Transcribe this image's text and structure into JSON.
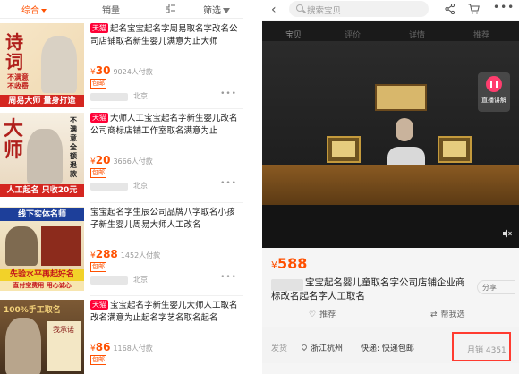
{
  "left": {
    "sort": {
      "comprehensive": "综合",
      "sales": "销量",
      "filter": "筛选"
    },
    "items": [
      {
        "badge": "天猫",
        "title": "起名宝宝起名字周易取名字改名公司店铺取名新生婴儿满意为止大师",
        "price_symbol": "¥",
        "price": "30",
        "sold": "9024人付款",
        "tag": "包邮",
        "location": "北京",
        "thumb": {
          "big": "诗词",
          "side": "不满意不收费",
          "band": "周易大师 量身打造"
        }
      },
      {
        "badge": "天猫",
        "title": "大师人工宝宝起名字新生婴儿改名公司商标店铺工作室取名满意为止",
        "price_symbol": "¥",
        "price": "20",
        "sold": "3666人付款",
        "tag": "包邮",
        "location": "北京",
        "thumb": {
          "big": "大师",
          "side": "不满意全额退款",
          "band": "人工起名 只收20元"
        }
      },
      {
        "badge": "",
        "title": "宝宝起名字生辰公司品牌八字取名小孩子新生婴儿周易大师人工改名",
        "price_symbol": "¥",
        "price": "288",
        "sold": "1452人付款",
        "tag": "包邮",
        "location": "北京",
        "thumb": {
          "top": "线下实体名师",
          "band": "先验水平再起好名",
          "sub": "直付宝费用 用心诚心"
        }
      },
      {
        "badge": "天猫",
        "title": "宝宝起名字新生婴儿大师人工取名改名满意为止起名字艺名取名起名",
        "price_symbol": "¥",
        "price": "86",
        "sold": "1168人付款",
        "tag": "包邮",
        "location": "",
        "thumb": {
          "top": "100%手工取名",
          "side": "我承诺"
        }
      }
    ]
  },
  "right": {
    "search_placeholder": "搜索宝贝",
    "video_tabs": [
      "宝贝",
      "评价",
      "详情",
      "推荐"
    ],
    "live_label": "直播讲解",
    "price_symbol": "¥",
    "price": "588",
    "title": "宝宝起名婴儿童取名字公司店铺企业商标改名起名字人工取名",
    "share": "分享",
    "actions": {
      "recommend": "推荐",
      "help": "帮我选"
    },
    "shipping": {
      "label": "发货",
      "location": "浙江杭州",
      "express": "快递: 快递包邮",
      "monthly_sales": "月销 4351"
    }
  }
}
